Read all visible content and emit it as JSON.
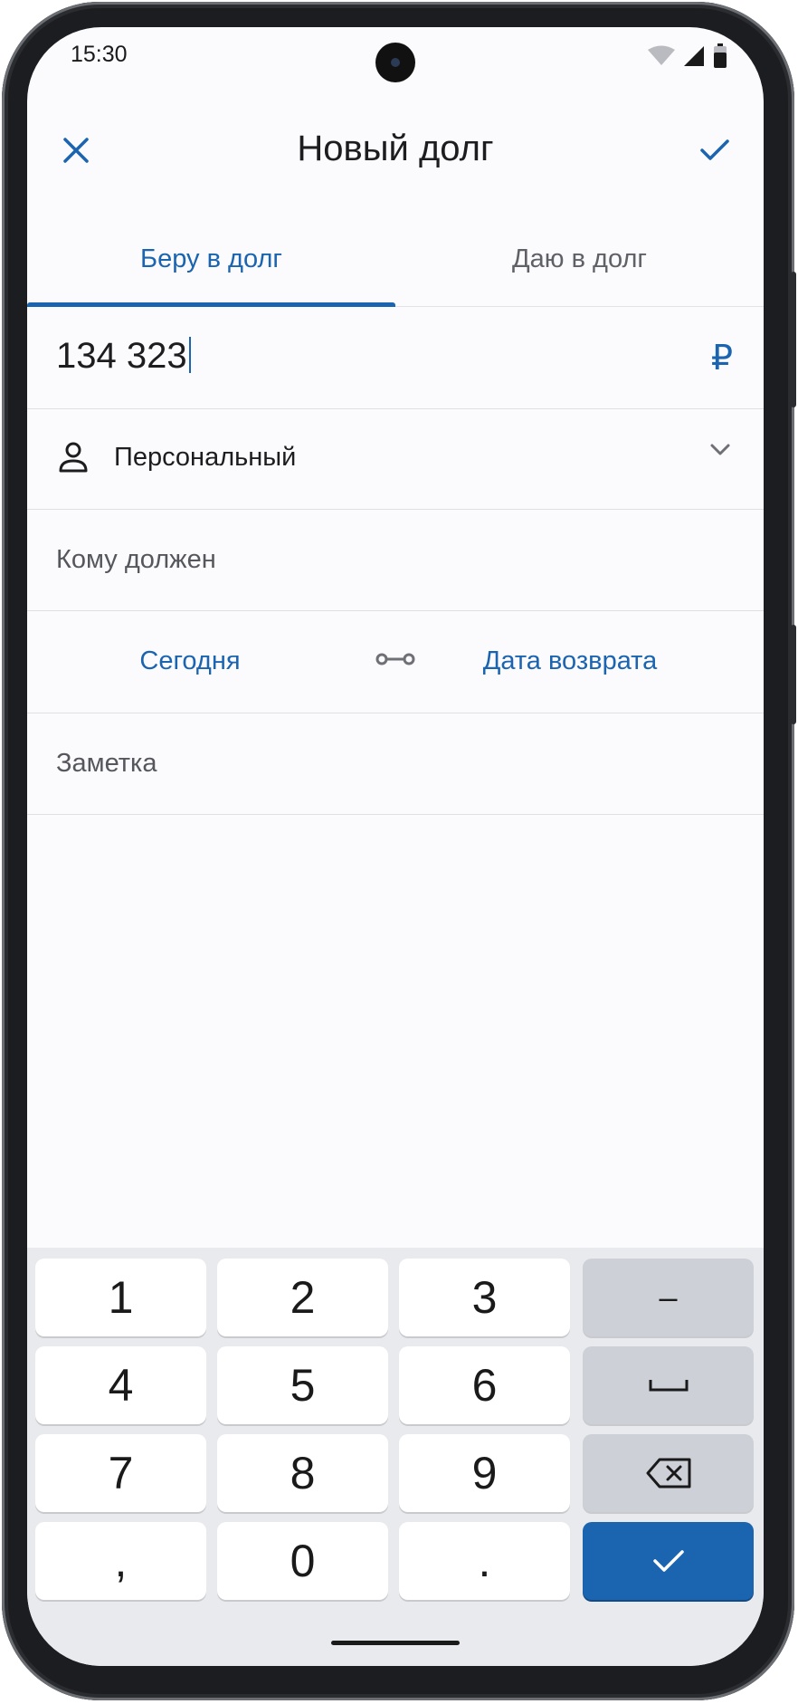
{
  "status_bar": {
    "time": "15:30"
  },
  "app_bar": {
    "title": "Новый долг",
    "close_icon": "close-icon",
    "confirm_icon": "check-icon"
  },
  "tabs": [
    {
      "label": "Беру в долг",
      "selected": true
    },
    {
      "label": "Даю в долг",
      "selected": false
    }
  ],
  "form": {
    "amount": "134 323",
    "currency": "₽",
    "category": {
      "icon": "person-icon",
      "label": "Персональный"
    },
    "to_whom_placeholder": "Кому должен",
    "date_start": "Сегодня",
    "date_link_icon": "link-icon",
    "date_return": "Дата возврата",
    "note_placeholder": "Заметка"
  },
  "keypad": {
    "keys": [
      "1",
      "2",
      "3",
      "–",
      "4",
      "5",
      "6",
      "space",
      "7",
      "8",
      "9",
      "backspace",
      ",",
      "0",
      ".",
      "ok"
    ],
    "labels": {
      "k1": "1",
      "k2": "2",
      "k3": "3",
      "k_minus": "–",
      "k4": "4",
      "k5": "5",
      "k6": "6",
      "k7": "7",
      "k8": "8",
      "k9": "9",
      "k_comma": ",",
      "k0": "0",
      "k_dot": "."
    }
  },
  "colors": {
    "accent": "#1b64b0",
    "background": "#fbfbfd",
    "keypad": "#e9eaee"
  }
}
